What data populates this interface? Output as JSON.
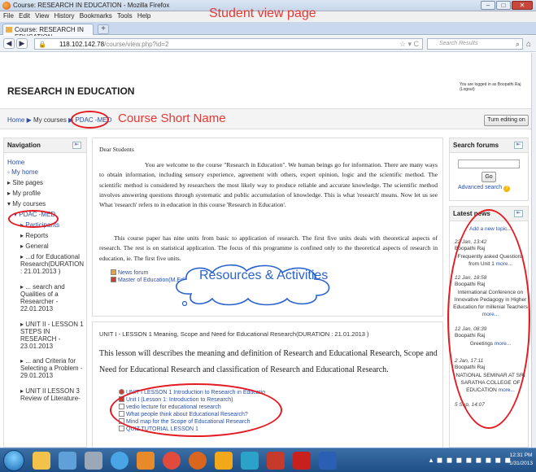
{
  "browser": {
    "window_title": "Course: RESEARCH IN EDUCATION - Mozilla Firefox",
    "menu": [
      "File",
      "Edit",
      "View",
      "History",
      "Bookmarks",
      "Tools",
      "Help"
    ],
    "tab_title": "Course: RESEARCH IN EDUCATION",
    "url_host": "118.102.142.78",
    "url_path": "/course/view.php?id=2",
    "search_placeholder": "Search Results"
  },
  "annotations": {
    "student_view": "Student view page",
    "course_short_name": "Course Short Name",
    "resources": "Resources & Activities"
  },
  "header": {
    "course_title": "RESEARCH IN EDUCATION",
    "logged_in": "You are logged in as Boopathi Raj (Logout)",
    "breadcrumb_home": "Home",
    "breadcrumb_courses": "My courses",
    "breadcrumb_course": "PDAC -MED",
    "turn_editing": "Turn editing on"
  },
  "navigation": {
    "title": "Navigation",
    "home": "Home",
    "my_home": "My home",
    "site_pages": "Site pages",
    "my_profile": "My profile",
    "my_courses": "My courses",
    "course": "PDAC -MED",
    "participants": "Participants",
    "reports": "Reports",
    "general": "General",
    "item1": "...d for Educational Research(DURATION : 21.01.2013 )",
    "item2": "... search and Qualities of a Researcher - 22.01.2013",
    "item3": "UNIT II - LESSON 1 STEPS IN RESEARCH - 23.01.2013",
    "item4": "... and Criteria for Selecting a Problem - 29.01.2013",
    "item5": "UNIT II LESSON 3 Review of Literature-"
  },
  "main": {
    "greeting": "Dear Students",
    "para1": "You are welcome to the course \"Research in Education\". We human beings go for information. There are many ways to obtain information, including sensory experience, agreement with others, expert opinion, logic and the scientific method. The scientific method is considered by researchers the most likely way to produce reliable and accurate knowledge. The scientific method involves answering questions through systematic and public accumulation of knowledge. This is what 'research' means. Now let us see What 'research' refers to in education in this course 'Research in Education'.",
    "para2": "This course paper has nine units from basic to application of research. The first five units deals with theoretical aspects of research. The rest is on statistical application. The focus of this programme is confined only to the theoretical aspects of research in education, ie. The first five units.",
    "link_news": "News forum",
    "link_syllabus": "Master of Education(M.Ed) - Syllabus",
    "unit_heading": "UNIT I - LESSON 1 Meaning, Scope and Need for Educational Research(DURATION : 21.01.2013 )",
    "lesson_text": "This lesson will describes the meaning and definition of Research and Educational Research, Scope and Need for Educational Research and classification of Research and Educational Research.",
    "resources": [
      "UNIT I LESSON 1 Introduction to Research in Educatio",
      "Unit I (Lesson 1: Introduction to Research)",
      "vedio lecture for educational research",
      "What people think about Educational Research?",
      "Mind map for the Scope of Educational Research",
      "QUIZ TUTORIAL LESSON 1"
    ]
  },
  "search_forums": {
    "title": "Search forums",
    "go": "Go",
    "advanced": "Advanced search"
  },
  "news": {
    "title": "Latest news",
    "add": "Add a new topic...",
    "items": [
      {
        "date": "22 Jan, 13:42",
        "author": "Boopathi Raj",
        "text": "Frequently asked Questions from Unit 1",
        "more": "more..."
      },
      {
        "date": "12 Jan, 18:58",
        "author": "Boopathi Raj",
        "text": "International Conference on Innovative Pedagogy in Higher Education for millenial Teachers",
        "more": "more..."
      },
      {
        "date": "12 Jan, 08:39",
        "author": "Boopathi Raj",
        "text": "Greetings",
        "more": "more..."
      },
      {
        "date": "2 Jan, 17:11",
        "author": "Boopathi Raj",
        "text": "NATIONAL SEMINAR AT SRI SARATHA COLLEGE OF EDUCATION",
        "more": "more..."
      }
    ],
    "last_date": "5 Sep, 14:07"
  },
  "taskbar": {
    "time": "12:31 PM",
    "date": "1/31/2013"
  }
}
